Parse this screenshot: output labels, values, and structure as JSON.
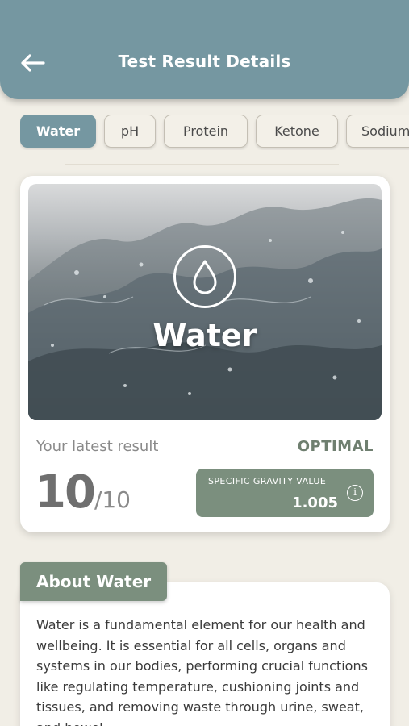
{
  "header": {
    "title": "Test Result Details",
    "back_icon": "arrow-left-icon"
  },
  "tabs": [
    {
      "label": "Water",
      "active": true
    },
    {
      "label": "pH",
      "active": false
    },
    {
      "label": "Protein",
      "active": false
    },
    {
      "label": "Ketone",
      "active": false
    },
    {
      "label": "Sodium",
      "active": false
    }
  ],
  "result": {
    "hero_title": "Water",
    "hero_icon": "water-drop-icon",
    "latest_label": "Your latest result",
    "status": "OPTIMAL",
    "score": "10",
    "score_max": "/10",
    "gravity_label": "SPECIFIC GRAVITY VALUE",
    "gravity_value": "1.005",
    "gravity_info_icon": "info-icon"
  },
  "about": {
    "title": "About Water",
    "text": "Water is a fundamental element for our health and wellbeing. It is essential for all cells, organs and systems in our bodies, performing crucial functions like regulating temperature, cushioning joints and tissues, and removing waste through urine, sweat, and bowel"
  },
  "colors": {
    "header": "#7597a1",
    "accent_green": "#7b8f7e",
    "background": "#f1eee6"
  }
}
